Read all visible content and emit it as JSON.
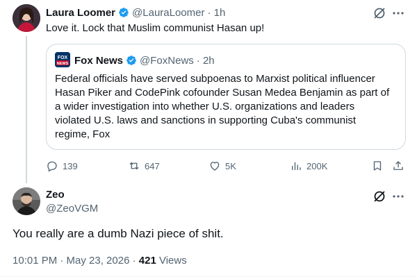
{
  "tweet1": {
    "name": "Laura Loomer",
    "handle": "@LauraLoomer",
    "time": "· 1h",
    "text": "Love it. Lock that Muslim communist Hasan up!",
    "quote": {
      "name": "Fox News",
      "handle": "@FoxNews",
      "time": "· 2h",
      "logo_text": "FOX NEWS",
      "text_lines": [
        "Federal officials have served subpoenas to Marxist political influencer",
        "Hasan Piker and CodePink cofounder Susan Medea Benjamin as part of",
        "a wider investigation into whether U.S. organizations and leaders",
        "violated U.S. laws and sanctions in supporting Cuba's communist",
        "regime, Fox"
      ]
    },
    "actions": {
      "replies": "139",
      "reposts": "647",
      "likes": "5K",
      "views": "200K"
    }
  },
  "tweet2": {
    "name": "Zeo",
    "handle": "@ZeoVGM",
    "text": "You really are a dumb Nazi piece of shit.",
    "timestamp": "10:01 PM · May 23, 2026 · ",
    "views_count": "421",
    "views_label": " Views"
  },
  "colors": {
    "verified_blue": "#1d9bf0",
    "text_primary": "#0f1419",
    "text_secondary": "#536471",
    "border": "#cfd9de",
    "fox_blue": "#003366"
  }
}
